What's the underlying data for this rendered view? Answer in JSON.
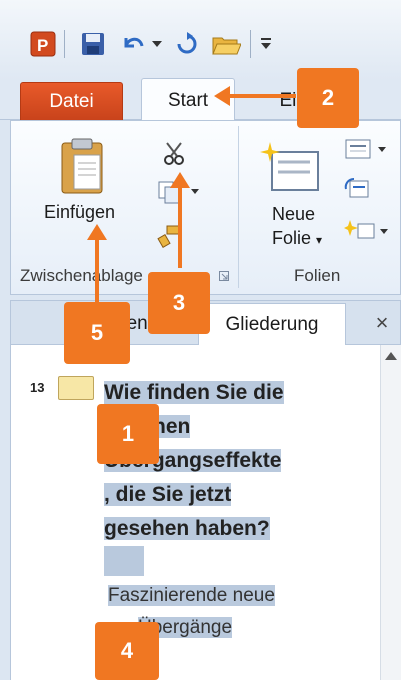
{
  "qat": {
    "icons": [
      "powerpoint-icon",
      "save-icon",
      "undo-icon",
      "undo-dropdown-icon",
      "redo-icon",
      "open-icon",
      "customize-icon"
    ]
  },
  "tabs": {
    "datei": "Datei",
    "start": "Start",
    "insert_partial": "Einfügen"
  },
  "clipboard": {
    "paste_label": "Einfügen",
    "group_label": "Zwischenablage"
  },
  "slides": {
    "new_slide_line1": "Neue",
    "new_slide_line2": "Folie",
    "group_label": "Folien"
  },
  "panel": {
    "tab_slides": "Folien",
    "tab_outline": "Gliederung",
    "close": "×"
  },
  "outline": {
    "slide_number": "13",
    "title": "Wie finden Sie die schönen Übergangseffekte, die Sie jetzt gesehen haben?",
    "title_lines": [
      "Wie finden Sie die",
      "schönen",
      "Übergangseffekte",
      ", die Sie jetzt",
      "gesehen haben?"
    ],
    "bullet_lines": [
      "Faszinierende neue",
      "Übergänge"
    ]
  },
  "callouts": {
    "c1": "1",
    "c2": "2",
    "c3": "3",
    "c4": "4",
    "c5": "5"
  },
  "colors": {
    "accent": "#f07722",
    "datei_tab": "#d24a1f",
    "highlight": "#b9c9dd"
  }
}
